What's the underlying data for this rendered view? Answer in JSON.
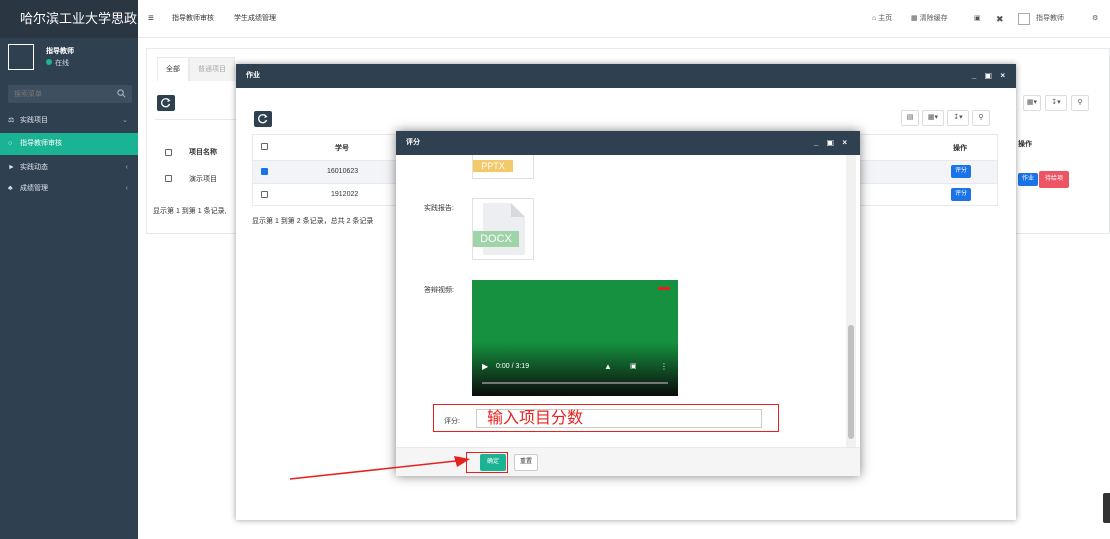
{
  "colors": {
    "sidebar": "#2f4050",
    "accent": "#1ab394",
    "danger": "#ed5565",
    "primary_blue": "#1a73e8",
    "annotation_red": "#e8211e"
  },
  "sidebar": {
    "logo": "哈尔滨工业大学思政",
    "user_name": "指导教师",
    "user_status": "在线",
    "search_placeholder": "搜索菜单",
    "items": [
      {
        "label": "实践项目",
        "icon": "graduation-cap-icon"
      },
      {
        "label": "指导教师审核",
        "icon": "circle-icon"
      },
      {
        "label": "实践动态",
        "icon": "volume-icon"
      },
      {
        "label": "成绩管理",
        "icon": "leaf-icon"
      }
    ]
  },
  "topbar": {
    "tabs": [
      "指导教师审核",
      "学生成绩管理"
    ],
    "home": "主页",
    "clear_cache": "清除缓存",
    "user": "指导教师"
  },
  "content": {
    "tab_all": "全部",
    "tab_normal": "普通项目",
    "col_name": "项目名称",
    "row_name": "演示项目",
    "col_action": "操作",
    "btn_homework": "作业",
    "btn_pending": "待给项",
    "summary": "显示第 1 到第 1 条记录,"
  },
  "modal1": {
    "title": "作业",
    "col_student_id": "学号",
    "col_action": "操作",
    "rows": [
      {
        "id": "16010623",
        "checked": true,
        "action": "评分"
      },
      {
        "id": "1912022",
        "checked": false,
        "action": "评分"
      }
    ],
    "summary": "显示第 1 到第 2 条记录，总共 2 条记录"
  },
  "modal2": {
    "title": "评分",
    "file_top_ext": "PPTX",
    "report_label": "实践报告:",
    "report_ext": "DOCX",
    "video_label": "答辩视频:",
    "video_time": "0:00 / 3:19",
    "score_label": "评分:",
    "score_placeholder": "输入项目分数",
    "btn_ok": "确定",
    "btn_reset": "重置"
  }
}
